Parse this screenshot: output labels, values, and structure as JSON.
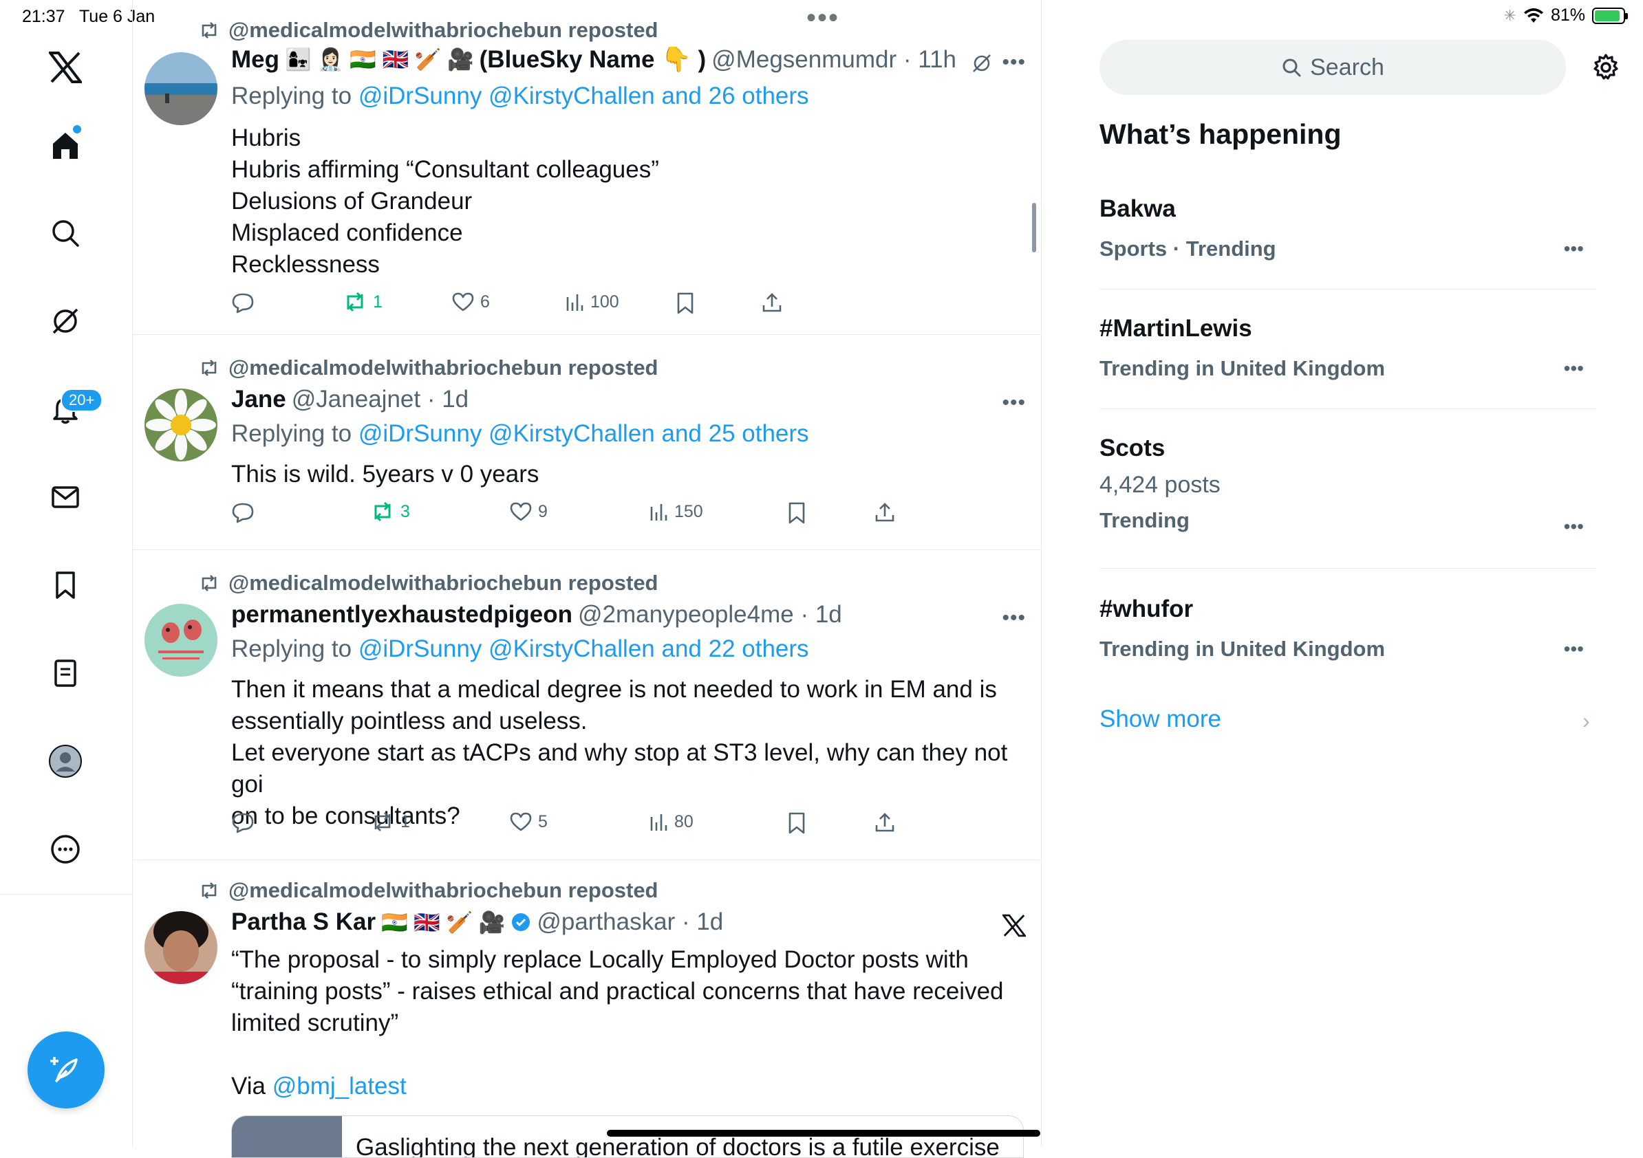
{
  "status_bar": {
    "time": "21:37",
    "date": "Tue 6 Jan",
    "battery": "81%",
    "battery_level": 0.81
  },
  "sidebar": {
    "items": [
      {
        "name": "x-logo"
      },
      {
        "name": "home"
      },
      {
        "name": "search"
      },
      {
        "name": "grok"
      },
      {
        "name": "notifications"
      },
      {
        "name": "messages"
      },
      {
        "name": "bookmarks"
      },
      {
        "name": "lists"
      },
      {
        "name": "profile"
      },
      {
        "name": "more"
      }
    ],
    "notifications_badge": "20+"
  },
  "timeline": {
    "posts": [
      {
        "repost_by": "@medicalmodelwithabriochebun reposted",
        "name": "Meg",
        "flags": "👩‍👧 👩🏻‍⚕️ 🇮🇳 🇬🇧 🏏 🎥",
        "name_suffix": "(BlueSky Name 👇 )",
        "handle_time": "@Megsenmumdr · 11h",
        "reply_prefix": "Replying to",
        "reply_to": "@iDrSunny @KirstyChallen and 26 others",
        "lines": [
          "Hubris",
          "Hubris affirming “Consultant colleagues”",
          "Delusions of Grandeur",
          "Misplaced confidence",
          "Recklessness"
        ],
        "reposts": "1",
        "likes": "6",
        "views": "100"
      },
      {
        "repost_by": "@medicalmodelwithabriochebun reposted",
        "name": "Jane",
        "handle_time": "@Janeajnet · 1d",
        "reply_prefix": "Replying to",
        "reply_to": "@iDrSunny @KirstyChallen and 25 others",
        "lines": [
          "This is wild. 5years v 0 years"
        ],
        "reposts": "3",
        "likes": "9",
        "views": "150"
      },
      {
        "repost_by": "@medicalmodelwithabriochebun reposted",
        "name": "permanentlyexhaustedpigeon",
        "handle_time": "@2manypeople4me · 1d",
        "reply_prefix": "Replying to",
        "reply_to": "@iDrSunny @KirstyChallen and 22 others",
        "lines": [
          "Then it means that a medical degree is not needed to work in EM and is",
          "essentially pointless and useless.",
          "Let everyone start as tACPs and why stop at ST3 level, why can they not goi",
          "on to be consultants?"
        ],
        "reposts": "1",
        "likes": "5",
        "views": "80"
      },
      {
        "repost_by": "@medicalmodelwithabriochebun reposted",
        "name": "Partha S Kar",
        "flags": "🇮🇳 🇬🇧 🏏 🎥",
        "handle_time": "@parthaskar · 1d",
        "lines": [
          "“The proposal - to simply replace Locally Employed Doctor posts with",
          "“training posts” - raises ethical and practical concerns that have received",
          "limited scrutiny”"
        ],
        "via_prefix": "Via",
        "via_link": "@bmj_latest",
        "card_text": "Gaslighting the next generation of doctors is a futile exercise"
      }
    ]
  },
  "right": {
    "search_placeholder": "Search",
    "heading": "What’s happening",
    "trends": [
      {
        "title": "Bakwa",
        "sub": "Sports · Trending"
      },
      {
        "title": "#MartinLewis",
        "sub": "Trending in United Kingdom"
      },
      {
        "title": "Scots",
        "posts": "4,424 posts",
        "sub": "Trending"
      },
      {
        "title": "#whufor",
        "sub": "Trending in United Kingdom"
      }
    ],
    "show_more": "Show more"
  }
}
